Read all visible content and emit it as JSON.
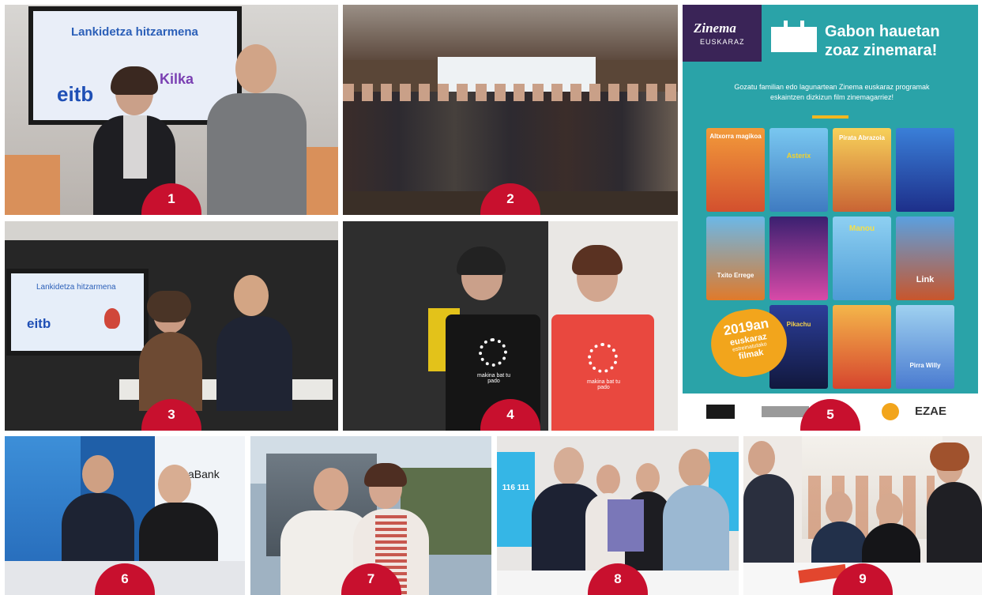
{
  "tiles": [
    {
      "badge": "1",
      "screen_title": "Lankidetza hitzarmena",
      "logo_left": "eitb",
      "logo_right": "Kilka"
    },
    {
      "badge": "2"
    },
    {
      "badge": "3",
      "screen_title": "Lankidetza hitzarmena",
      "logo_left": "eitb"
    },
    {
      "badge": "4",
      "shirt_text": "makina bat tu pado"
    },
    {
      "badge": "5"
    },
    {
      "badge": "6",
      "banner_text": "CaixaBank"
    },
    {
      "badge": "7"
    },
    {
      "badge": "8",
      "poster_number": "116 111"
    },
    {
      "badge": "9"
    }
  ],
  "poster": {
    "brand_line1": "Zinema",
    "brand_line2": "EUSKARAZ",
    "headline_line1": "Gabon hauetan",
    "headline_line2": "zoaz zinemara!",
    "subtitle": "Gozatu familian edo lagunartean Zinema euskaraz programak eskaintzen dizkizun film zinemagarriez!",
    "sticker_year": "2019an",
    "sticker_line2": "euskaraz",
    "sticker_line3": "estreinatutako",
    "sticker_line4": "filmak",
    "sponsor_right": "EZAE",
    "film_titles": [
      "Altxorra magikoa",
      "Asterix",
      "Pirata Abrazoia",
      "",
      "Txito Errege",
      "",
      "Manou",
      "Link",
      "Pikachu",
      "",
      "",
      "Pirra Willy"
    ],
    "accent": "#2aa3a8"
  }
}
